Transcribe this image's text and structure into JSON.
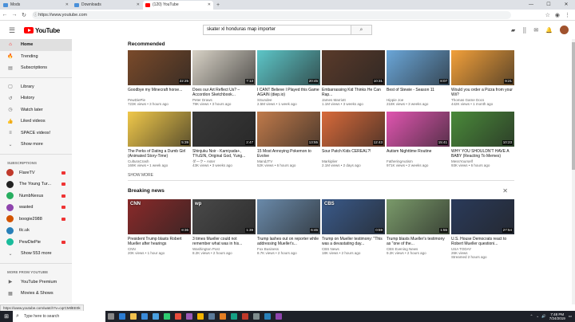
{
  "browser": {
    "tabs": [
      {
        "label": "Mods",
        "active": false,
        "fav_color": "#4a90d9"
      },
      {
        "label": "Downloads",
        "active": false,
        "fav_color": "#4a90d9"
      },
      {
        "label": "(120) YouTube",
        "active": true,
        "fav_color": "#ff0000"
      }
    ],
    "url": "https://www.youtube.com",
    "minimize": "—",
    "maximize": "☐",
    "close": "✕"
  },
  "header": {
    "logo_text": "YouTube",
    "search_value": "skater xl honduras map importer"
  },
  "sidebar": {
    "main_items": [
      {
        "label": "Home",
        "icon": "home-icon",
        "glyph": "⌂",
        "active": true
      },
      {
        "label": "Trending",
        "icon": "flame-icon",
        "glyph": "🔥",
        "active": false
      },
      {
        "label": "Subscriptions",
        "icon": "subscriptions-icon",
        "glyph": "▤",
        "active": false
      }
    ],
    "lib_items": [
      {
        "label": "Library",
        "icon": "library-icon",
        "glyph": "▢"
      },
      {
        "label": "History",
        "icon": "history-icon",
        "glyph": "↺"
      },
      {
        "label": "Watch later",
        "icon": "clock-icon",
        "glyph": "◷"
      },
      {
        "label": "Liked videos",
        "icon": "thumbs-up-icon",
        "glyph": "👍"
      },
      {
        "label": "SPACE videos!",
        "icon": "playlist-icon",
        "glyph": "≡"
      },
      {
        "label": "Show more",
        "icon": "chevron-down-icon",
        "glyph": "⌄"
      }
    ],
    "subs_heading": "SUBSCRIPTIONS",
    "subs": [
      {
        "label": "FlareTV",
        "color": "#c0392b",
        "live": true
      },
      {
        "label": "The Young Tur...",
        "color": "#222",
        "live": true
      },
      {
        "label": "NumbNexus",
        "color": "#27ae60",
        "live": true
      },
      {
        "label": "wasted",
        "color": "#8e44ad",
        "live": true
      },
      {
        "label": "boogie2988",
        "color": "#d35400",
        "live": true
      },
      {
        "label": "tlc.uk",
        "color": "#2980b9",
        "live": false
      },
      {
        "label": "PewDiePie",
        "color": "#1abc9c",
        "live": true
      },
      {
        "label": "Show 553 more",
        "color": "",
        "live": false
      }
    ],
    "more_heading": "MORE FROM YOUTUBE",
    "more": [
      {
        "label": "YouTube Premium",
        "icon": "youtube-icon",
        "glyph": "▶"
      },
      {
        "label": "Movies & Shows",
        "icon": "film-icon",
        "glyph": "▦"
      }
    ]
  },
  "recommended": {
    "heading": "Recommended",
    "show_more": "SHOW MORE",
    "rows": [
      [
        {
          "title": "Goodbye my Minecraft horse...",
          "channel": "PewDiePie",
          "meta": "723K views • 3 hours ago",
          "dur": "22:25",
          "bg": "#7a4a2a"
        },
        {
          "title": "Does our Art Reflect Us? – Accordion Sketchbook...",
          "channel": "Peter Draws",
          "meta": "79K views • 3 hours ago",
          "dur": "7:13",
          "bg": "#d8d2c6"
        },
        {
          "title": "I CANT Believe I Played this Game AGAIN (diep.io)",
          "channel": "SSundee",
          "meta": "2.5M views • 1 week ago",
          "dur": "20:45",
          "bg": "#5dc6c8"
        },
        {
          "title": "Embarrassing Kid Thinks He Can Rap...",
          "channel": "James Marriott",
          "meta": "1.1M views • 3 weeks ago",
          "dur": "10:31",
          "bg": "#5a3a2a"
        },
        {
          "title": "Best of Stewie - Season 11",
          "channel": "Hippie Joe",
          "meta": "218K views • 3 weeks ago",
          "dur": "8:07",
          "bg": "#6aa6d8"
        },
        {
          "title": "Would you order a Pizza from your Wii?",
          "channel": "Thomas Game Docs",
          "meta": "442K views • 1 month ago",
          "dur": "9:21",
          "bg": "#f2a03a"
        }
      ],
      [
        {
          "title": "The Perks of Dating a Dumb Girl (Animated Story-Time)",
          "channel": "CulturaCrash",
          "meta": "169K views • 1 week ago",
          "dur": "5:39",
          "bg": "#f0c84a"
        },
        {
          "title": "Shinjuku Noir - Kamiyada+, TYuSIN, Original God, Yung...",
          "channel": "ダーク・Aster",
          "meta": "43K views • 3 weeks ago",
          "dur": "2:47",
          "bg": "#3a3a3a"
        },
        {
          "title": "15 Most Annoying Pokemon to Evolve",
          "channel": "MandJTV",
          "meta": "52K views • 6 hours ago",
          "dur": "13:55",
          "bg": "#c07a4a"
        },
        {
          "title": "Sour Patch Kids CEREAL?!",
          "channel": "Markiplier",
          "meta": "2.1M views • 2 days ago",
          "dur": "12:43",
          "bg": "#d86a3a"
        },
        {
          "title": "Autism Nighttime Routine",
          "channel": "FatheringAutism",
          "meta": "971K views • 2 weeks ago",
          "dur": "15:41",
          "bg": "#e055b0"
        },
        {
          "title": "WHY YOU SHOULDN'T HAVE A BABY (Reacting To Memes)",
          "channel": "MessYourself",
          "meta": "93K views • 6 hours ago",
          "dur": "10:23",
          "bg": "#4a8a3a"
        }
      ]
    ]
  },
  "breaking": {
    "heading": "Breaking news",
    "close": "✕",
    "items": [
      {
        "title": "President Trump blasts Robert Mueller after hearings",
        "channel": "CNN",
        "meta": "20K views • 1 hour ago",
        "dur": "8:36",
        "bg": "#8a2a2a",
        "badge": "CNN"
      },
      {
        "title": "3 times Mueller could not remember what was in his...",
        "channel": "Washington Post",
        "meta": "8.2K views • 2 hours ago",
        "dur": "1:39",
        "bg": "#4a4a4a",
        "badge": "wp"
      },
      {
        "title": "Trump lashes out on reporter while addressing Mueller's...",
        "channel": "Fox Business",
        "meta": "8.7K views • 2 hours ago",
        "dur": "6:46",
        "bg": "#6a8aaa",
        "badge": ""
      },
      {
        "title": "Trump on Mueller testimony: \"This was a devastating day...",
        "channel": "CBS News",
        "meta": "18K views • 2 hours ago",
        "dur": "0:59",
        "bg": "#3a5a8a",
        "badge": "CBS"
      },
      {
        "title": "Trump blasts Mueller's testimony as \"one of the...",
        "channel": "CBS Evening News",
        "meta": "9.2K views • 2 hours ago",
        "dur": "1:55",
        "bg": "#7a9a6a",
        "badge": ""
      },
      {
        "title": "U.S. House Democrats react to Robert Mueller questioni...",
        "channel": "USA TODAY",
        "meta": "26K views",
        "meta2": "Streamed 2 hours ago",
        "dur": "27:54",
        "bg": "#2a3a5a",
        "badge": ""
      }
    ]
  },
  "status_url": "https://www.youtube.com/watch?v=cqrCMtlEE0k",
  "taskbar": {
    "search_placeholder": "Type here to search",
    "time": "7:48 PM",
    "date": "7/24/2019",
    "icons": [
      {
        "name": "task-view-icon",
        "color": "#888"
      },
      {
        "name": "edge-icon",
        "color": "#2b7cd3"
      },
      {
        "name": "explorer-icon",
        "color": "#f2c14e"
      },
      {
        "name": "store-icon",
        "color": "#3a8ad8"
      },
      {
        "name": "mail-icon",
        "color": "#4aa0e0"
      },
      {
        "name": "app-icon",
        "color": "#2ecc71"
      },
      {
        "name": "app-icon",
        "color": "#e74c3c"
      },
      {
        "name": "app-icon",
        "color": "#9b59b6"
      },
      {
        "name": "chrome-icon",
        "color": "#f4b400"
      },
      {
        "name": "steam-icon",
        "color": "#5a7a9a"
      },
      {
        "name": "app-icon",
        "color": "#e67e22"
      },
      {
        "name": "app-icon",
        "color": "#16a085"
      },
      {
        "name": "app-icon",
        "color": "#c0392b"
      },
      {
        "name": "app-icon",
        "color": "#7f8c8d"
      },
      {
        "name": "app-icon",
        "color": "#2980b9"
      },
      {
        "name": "app-icon",
        "color": "#8e44ad"
      }
    ]
  }
}
